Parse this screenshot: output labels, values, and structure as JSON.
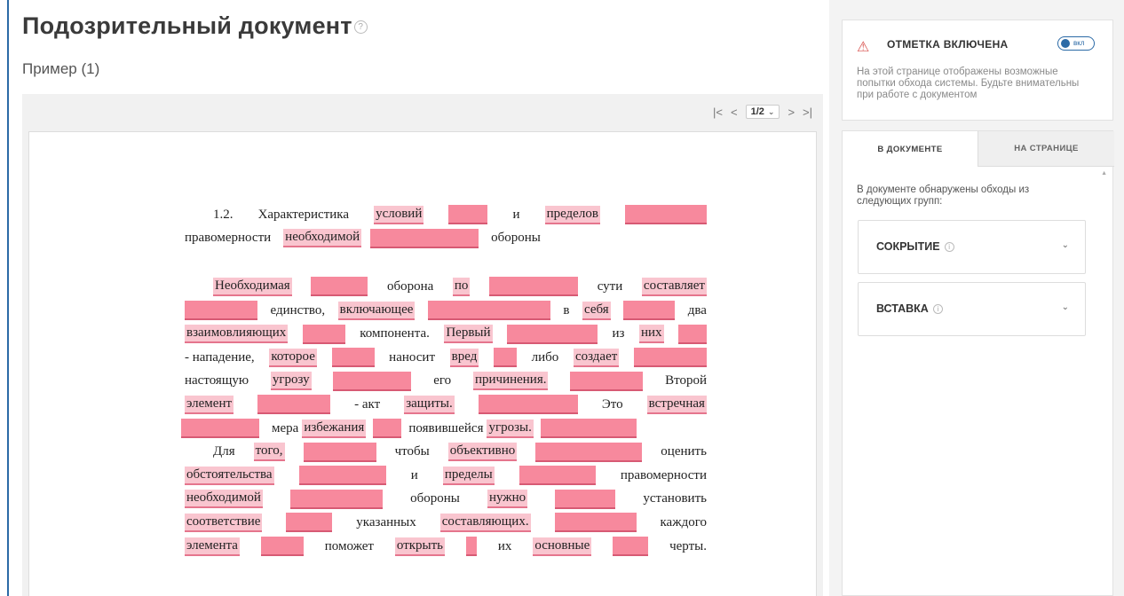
{
  "header": {
    "title": "Подозрительный документ",
    "subtitle": "Пример (1)",
    "help_icon": "question-circle-icon"
  },
  "viewer": {
    "pager": {
      "first": "|<",
      "prev": "<",
      "current": "1/2",
      "next": ">",
      "last": ">|"
    },
    "text_lines": [
      [
        "1.2.",
        "Характеристика",
        "условий",
        "и",
        "пределов"
      ],
      [
        "правомерности",
        "необходимой",
        "обороны"
      ],
      [
        "Необходимая",
        "оборона",
        "по",
        "сути",
        "составляет"
      ],
      [
        "единство,",
        "включающее",
        "в",
        "себя",
        "два"
      ],
      [
        "взаимовлияющих",
        "компонента.",
        "Первый",
        "из",
        "них"
      ],
      [
        "- нападение,",
        "которое",
        "наносит",
        "вред",
        "либо",
        "создает"
      ],
      [
        "настоящую",
        "угрозу",
        "его",
        "причинения.",
        "Второй"
      ],
      [
        "элемент",
        "- акт",
        "защиты.",
        "Это",
        "встречная"
      ],
      [
        "мера",
        "избежания",
        "появившейся",
        "угрозы."
      ],
      [
        "Для",
        "того,",
        "чтобы",
        "объективно",
        "оценить"
      ],
      [
        "обстоятельства",
        "и",
        "пределы",
        "правомерности"
      ],
      [
        "необходимой",
        "обороны",
        "нужно",
        "установить"
      ],
      [
        "соответствие",
        "указанных",
        "составляющих.",
        "каждого"
      ],
      [
        "элемента",
        "поможет",
        "открыть",
        "их",
        "основные",
        "черты."
      ]
    ]
  },
  "alert": {
    "title": "ОТМЕТКА ВКЛЮЧЕНА",
    "toggle_label": "вкл",
    "text": "На этой странице отображены возможные попытки обхода системы. Будьте внимательны при работе с документом",
    "accent": "#d9534f",
    "toggle_color": "#2b6aa6"
  },
  "panel": {
    "tabs": [
      {
        "label": "В ДОКУМЕНТЕ"
      },
      {
        "label": "НА СТРАНИЦЕ"
      }
    ],
    "found_text": "В документе обнаружены обходы из следующих групп:",
    "groups": [
      {
        "label": "СОКРЫТИЕ"
      },
      {
        "label": "ВСТАВКА"
      }
    ]
  },
  "colors": {
    "highlight_word": "#f9c5cf",
    "highlight_block": "#f7899d",
    "accent_blue": "#2b6aa6"
  }
}
